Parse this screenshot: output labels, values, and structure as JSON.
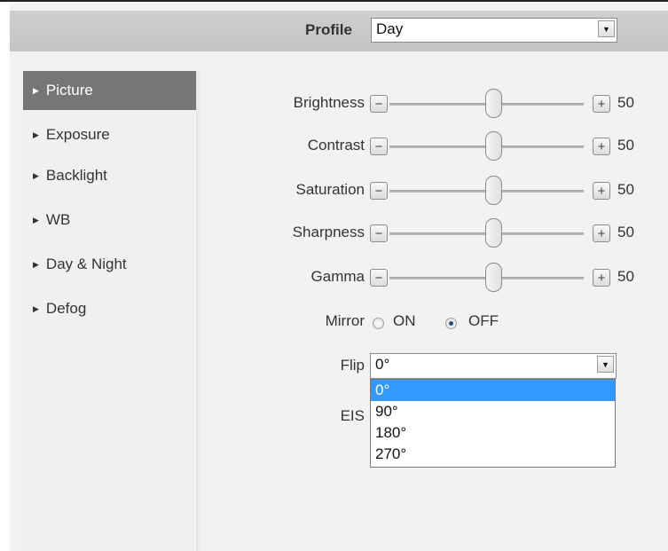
{
  "header": {
    "profile_label": "Profile",
    "profile_value": "Day"
  },
  "sidebar": {
    "items": [
      {
        "label": "Picture",
        "active": true
      },
      {
        "label": "Exposure",
        "active": false
      },
      {
        "label": "Backlight",
        "active": false
      },
      {
        "label": "WB",
        "active": false
      },
      {
        "label": "Day & Night",
        "active": false
      },
      {
        "label": "Defog",
        "active": false
      }
    ]
  },
  "sliders": [
    {
      "label": "Brightness",
      "value": "50",
      "minus": "−",
      "plus": "+"
    },
    {
      "label": "Contrast",
      "value": "50",
      "minus": "−",
      "plus": "+"
    },
    {
      "label": "Saturation",
      "value": "50",
      "minus": "−",
      "plus": "+"
    },
    {
      "label": "Sharpness",
      "value": "50",
      "minus": "−",
      "plus": "+"
    },
    {
      "label": "Gamma",
      "value": "50",
      "minus": "−",
      "plus": "+"
    }
  ],
  "mirror": {
    "label": "Mirror",
    "on_label": "ON",
    "off_label": "OFF",
    "selected": "OFF"
  },
  "flip": {
    "label": "Flip",
    "value": "0°",
    "options": [
      "0°",
      "90°",
      "180°",
      "270°"
    ],
    "highlighted": "0°"
  },
  "eis": {
    "label": "EIS"
  },
  "colors": {
    "active_nav_bg": "#767676",
    "option_highlight": "#3399ff",
    "header_bg": "#c8c8c8"
  }
}
